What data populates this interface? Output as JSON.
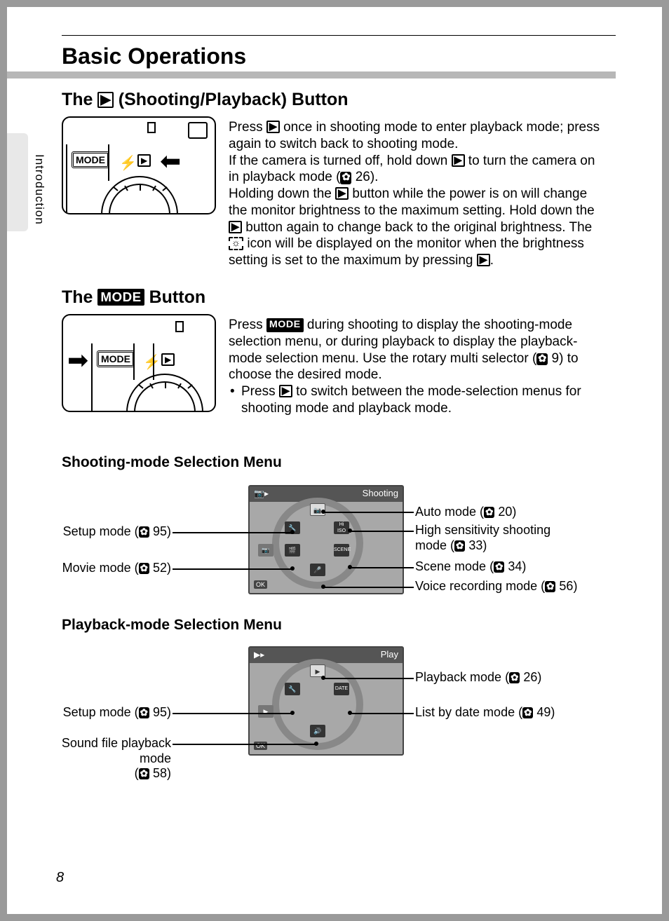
{
  "sideTab": "Introduction",
  "mainTitle": "Basic Operations",
  "section1": {
    "titlePrefix": "The",
    "titleSuffix": "(Shooting/Playback) Button",
    "p1a": "Press ",
    "p1b": " once in shooting mode to enter playback mode; press again to switch back to shooting mode.",
    "p2a": "If the camera is turned off, hold down ",
    "p2b": " to turn the camera on in playback mode (",
    "p2c": " 26).",
    "p3a": "Holding down the ",
    "p3b": " button while the power is on will change the monitor brightness to the maximum setting. Hold down the ",
    "p3c": " button again to change back to the original brightness. The ",
    "p3d": " icon will be displayed on the monitor when the brightness setting is set to the maximum by pressing ",
    "p3e": "."
  },
  "section2": {
    "titlePrefix": "The",
    "titleSuffix": "Button",
    "p1a": "Press ",
    "p1b": " during shooting to display the shooting-mode selection menu, or during playback to display the playback-mode selection menu. Use the rotary multi selector (",
    "p1c": " 9) to choose the desired mode.",
    "bullet1a": "Press ",
    "bullet1b": " to switch between the mode-selection menus for shooting mode and playback mode."
  },
  "shootingMenu": {
    "title": "Shooting-mode Selection Menu",
    "header": "Shooting",
    "left": {
      "setup": {
        "label": "Setup mode (",
        "page": " 95)"
      },
      "movie": {
        "label": "Movie mode (",
        "page": " 52)"
      }
    },
    "right": {
      "auto": {
        "label": "Auto mode (",
        "page": " 20)"
      },
      "highiso": {
        "label1": "High sensitivity shooting",
        "label2": "mode (",
        "page": " 33)"
      },
      "scene": {
        "label": "Scene mode (",
        "page": " 34)"
      },
      "voice": {
        "label": "Voice recording mode (",
        "page": " 56)"
      }
    }
  },
  "playbackMenu": {
    "title": "Playback-mode Selection Menu",
    "header": "Play",
    "left": {
      "setup": {
        "label": "Setup mode (",
        "page": " 95)"
      },
      "sound": {
        "label1": "Sound file playback mode",
        "label2": "(",
        "page": " 58)"
      }
    },
    "right": {
      "playback": {
        "label": "Playback mode (",
        "page": " 26)"
      },
      "listdate": {
        "label": "List by date mode (",
        "page": " 49)"
      }
    }
  },
  "modeWord": "MODE",
  "okWord": "OK",
  "pageNumber": "8",
  "glyphs": {
    "play": "▶",
    "camera": "📷",
    "ref": "✿",
    "brightness": "☼",
    "flash": "⚡",
    "arrowRight": "➡",
    "arrowLeft": "⬅"
  }
}
